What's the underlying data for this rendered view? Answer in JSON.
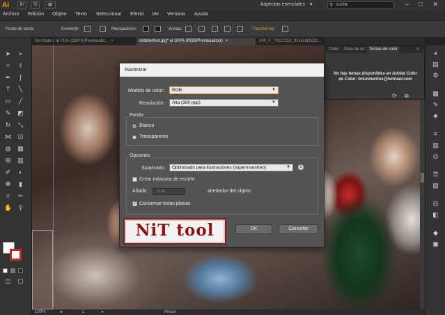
{
  "app": {
    "logo": "Ai",
    "br_label": "Br",
    "st_label": "St",
    "workspace": "Aspectos esenciales",
    "search_value": "coche",
    "window_controls": "–  □  ✕"
  },
  "menu": [
    "Archivo",
    "Edición",
    "Objeto",
    "Texto",
    "Seleccionar",
    "Efecto",
    "Ver",
    "Ventana",
    "Ayuda"
  ],
  "controlbar": {
    "anchor_point": "Punto de ancla",
    "convert": "Convertir:",
    "handles": "Manejadores:",
    "anchors": "Anclas:",
    "transform": "Transformar"
  },
  "doc_tabs": [
    {
      "label": "Sin título-1 al 71% (CMYK/Previsualiz...",
      "close": "×"
    },
    {
      "label": "oktoberfest.jpg* al 100% (RGB/Previsualizar)",
      "close": "×"
    },
    {
      "label": "240_F_79227252_fRJxLbl3XZz...",
      "close": ""
    }
  ],
  "color_panel": {
    "tabs": [
      "Color",
      "Guía de co",
      "Temas de color"
    ],
    "message": "No hay temas disponibles en Adobe Color de Color: briunmentos@hotmail.com"
  },
  "dialog": {
    "title": "Rasterizar",
    "color_model_label": "Modelo de color:",
    "color_model_value": "RGB",
    "resolution_label": "Resolución:",
    "resolution_value": "Alta (300 ppp)",
    "background_label": "Fondo",
    "bg_white": "Blanco",
    "bg_transparent": "Transparente",
    "options_label": "Opciones",
    "antialias_label": "Suavizado:",
    "antialias_value": "Optimizado para ilustraciones (supermuestreo)",
    "clip_mask_label": "Crear máscara de recorte",
    "add_label": "Añadir:",
    "add_value": "0 pt",
    "around_label": "alrededor del objeto",
    "spot_colors_label": "Conservar tintas planas",
    "ok": "OK",
    "cancel": "Cancelar"
  },
  "status": {
    "zoom": "100%",
    "page": "1",
    "tool": "Pincel"
  },
  "watermark": "NiT tool",
  "colors": {
    "accent": "#e8a23b",
    "stroke_red": "#c8232c",
    "watermark_red": "#8c1414"
  }
}
